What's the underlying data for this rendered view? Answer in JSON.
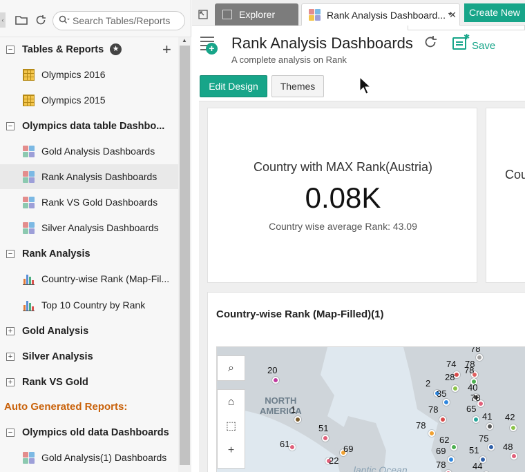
{
  "sidebar": {
    "search_placeholder": "Search Tables/Reports",
    "section_title": "Tables & Reports",
    "items": [
      {
        "label": "Olympics 2016",
        "kind": "table"
      },
      {
        "label": "Olympics 2015",
        "kind": "table"
      },
      {
        "label": "Olympics data table Dashbo...",
        "kind": "group",
        "state": "expanded"
      },
      {
        "label": "Gold Analysis Dashboards",
        "kind": "dashboard"
      },
      {
        "label": "Rank Analysis Dashboards",
        "kind": "dashboard",
        "selected": true
      },
      {
        "label": "Rank VS Gold Dashboards",
        "kind": "dashboard"
      },
      {
        "label": "Silver Analysis Dashboards",
        "kind": "dashboard"
      },
      {
        "label": "Rank Analysis",
        "kind": "group",
        "state": "expanded"
      },
      {
        "label": "Country-wise Rank (Map-Fil...",
        "kind": "chart"
      },
      {
        "label": "Top 10 Country by Rank",
        "kind": "chart"
      },
      {
        "label": "Gold Analysis",
        "kind": "group",
        "state": "collapsed"
      },
      {
        "label": "Silver Analysis",
        "kind": "group",
        "state": "collapsed"
      },
      {
        "label": "Rank VS Gold",
        "kind": "group",
        "state": "collapsed"
      },
      {
        "label": "Auto Generated Reports:",
        "kind": "heading"
      },
      {
        "label": "Olympics old data Dashboards",
        "kind": "group",
        "state": "expanded"
      },
      {
        "label": "Gold Analysis(1) Dashboards",
        "kind": "dashboard"
      }
    ]
  },
  "tabs": {
    "explorer": "Explorer",
    "active": "Rank Analysis Dashboard... *",
    "create_new": "Create New"
  },
  "header": {
    "title": "Rank Analysis Dashboards",
    "subtitle": "A complete analysis on Rank",
    "save": "Save",
    "edit_design": "Edit Design",
    "themes": "Themes"
  },
  "kpi": {
    "title": "Country with MAX Rank(Austria)",
    "value": "0.08K",
    "subtitle": "Country wise average Rank: 43.09"
  },
  "kpi2": {
    "title_fragment": "Cou"
  },
  "map": {
    "title": "Country-wise Rank (Map-Filled)(1)",
    "regions": [
      "NORTH\nAMERICA",
      "...lantic Ocean"
    ],
    "labels": [
      "20",
      "1",
      "61",
      "51",
      "69",
      "22",
      "74",
      "78",
      "2",
      "35",
      "28",
      "78",
      "40",
      "78",
      "78",
      "65",
      "41",
      "42",
      "78",
      "62",
      "75",
      "48",
      "69",
      "78",
      "51",
      "44",
      "78"
    ]
  },
  "colors": {
    "accent": "#17a589",
    "sidebar_orange": "#c9620b"
  }
}
